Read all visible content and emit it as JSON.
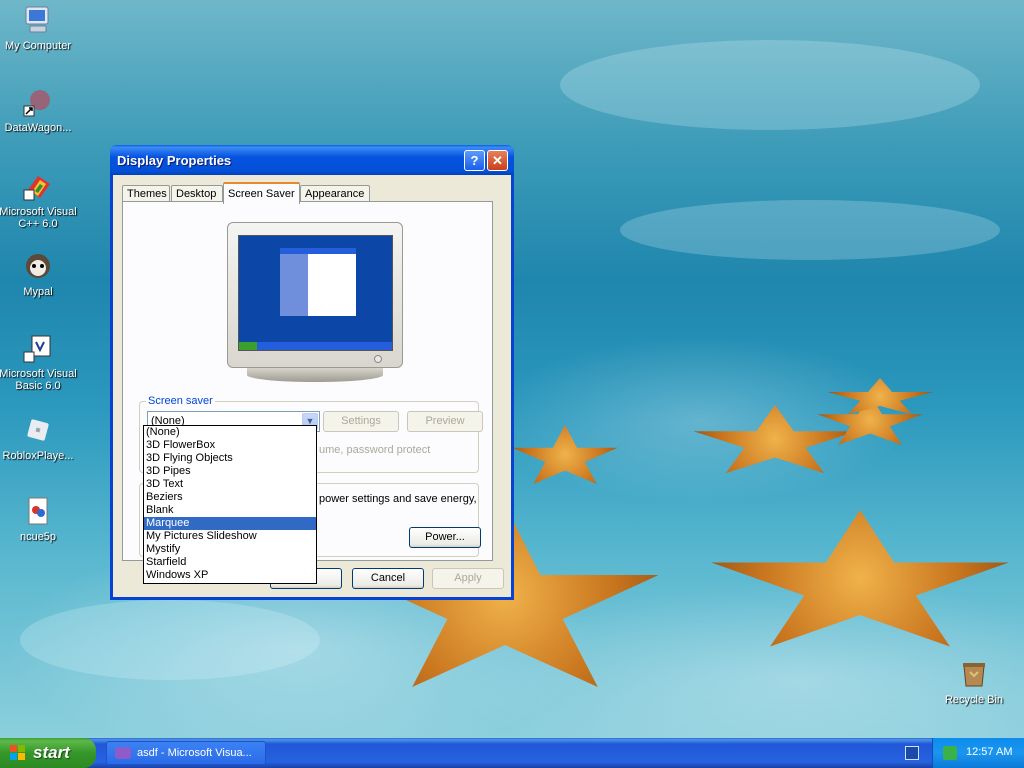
{
  "desktop": {
    "icons": [
      {
        "label": "My Computer",
        "icon": "computer-icon"
      },
      {
        "label": "DataWagon...",
        "icon": "shortcut-icon"
      },
      {
        "label": "Microsoft Visual C++ 6.0",
        "icon": "visual-cpp-icon"
      },
      {
        "label": "Mypal",
        "icon": "mypal-icon"
      },
      {
        "label": "Microsoft Visual Basic 6.0",
        "icon": "visual-basic-icon"
      },
      {
        "label": "RobloxPlaye...",
        "icon": "roblox-icon"
      },
      {
        "label": "ncue5p",
        "icon": "file-icon"
      },
      {
        "label": "Recycle Bin",
        "icon": "recycle-bin-icon"
      }
    ]
  },
  "window": {
    "title": "Display Properties",
    "help_glyph": "?",
    "close_glyph": "✕",
    "tabs": [
      "Themes",
      "Desktop",
      "Screen Saver",
      "Appearance"
    ],
    "active_tab": "Screen Saver",
    "screen_saver": {
      "group_label": "Screen saver",
      "selected": "(None)",
      "settings_label": "Settings",
      "preview_label": "Preview",
      "partial_text": "ume, password protect",
      "options": [
        "(None)",
        "3D FlowerBox",
        "3D Flying Objects",
        "3D Pipes",
        "3D Text",
        "Beziers",
        "Blank",
        "Marquee",
        "My Pictures Slideshow",
        "Mystify",
        "Starfield",
        "Windows XP"
      ],
      "highlighted": "Marquee"
    },
    "power": {
      "partial_text_1": "power settings and save energy,",
      "button_label": "Power..."
    },
    "footer": {
      "cancel_label": "Cancel",
      "apply_label": "Apply"
    }
  },
  "taskbar": {
    "start_label": "start",
    "task_label": "asdf - Microsoft Visua...",
    "clock": "12:57 AM"
  },
  "colors": {
    "titlebar": "#0553e0",
    "selection": "#316ac5",
    "start_green": "#3c9e2e"
  }
}
